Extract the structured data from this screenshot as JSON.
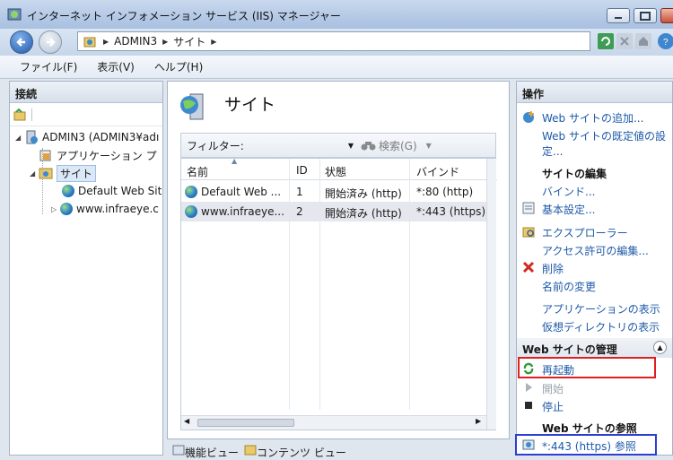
{
  "window": {
    "title": "インターネット インフォメーション サービス (IIS) マネージャー"
  },
  "address": {
    "crumbs": [
      "ADMIN3",
      "サイト"
    ]
  },
  "menu": {
    "file": "ファイル(F)",
    "view": "表示(V)",
    "help": "ヘルプ(H)"
  },
  "connections": {
    "header": "接続",
    "server": "ADMIN3 (ADMIN3¥adı",
    "app_pools": "アプリケーション プ",
    "sites": "サイト",
    "site1": "Default Web Sit",
    "site2": "www.infraeye.c"
  },
  "center": {
    "title": "サイト",
    "filter_label": "フィルター:",
    "search_label": "検索(G)",
    "columns": [
      "名前",
      "ID",
      "状態",
      "バインド"
    ],
    "rows": [
      {
        "name": "Default Web ...",
        "id": "1",
        "status": "開始済み (http)",
        "binding": "*:80 (http)"
      },
      {
        "name": "www.infraeye...",
        "id": "2",
        "status": "開始済み (http)",
        "binding": "*:443 (https)"
      }
    ],
    "tab_features": "機能ビュー",
    "tab_content": "コンテンツ ビュー"
  },
  "actions": {
    "header": "操作",
    "add_site": "Web サイトの追加...",
    "set_defaults_1": "Web サイトの既定値の設",
    "set_defaults_2": "定...",
    "edit_site": "サイトの編集",
    "bindings": "バインド...",
    "basic_settings": "基本設定...",
    "explore": "エクスプローラー",
    "edit_permissions": "アクセス許可の編集...",
    "remove": "削除",
    "rename": "名前の変更",
    "view_apps": "アプリケーションの表示",
    "view_vdirs": "仮想ディレクトリの表示",
    "manage_site": "Web サイトの管理",
    "restart": "再起動",
    "start": "開始",
    "stop": "停止",
    "browse_site": "Web サイトの参照",
    "browse_443": "*:443 (https) 参照"
  },
  "colors": {
    "link": "#1e5aa8",
    "highlight_red": "#e02020",
    "highlight_blue": "#2d3fd1"
  }
}
